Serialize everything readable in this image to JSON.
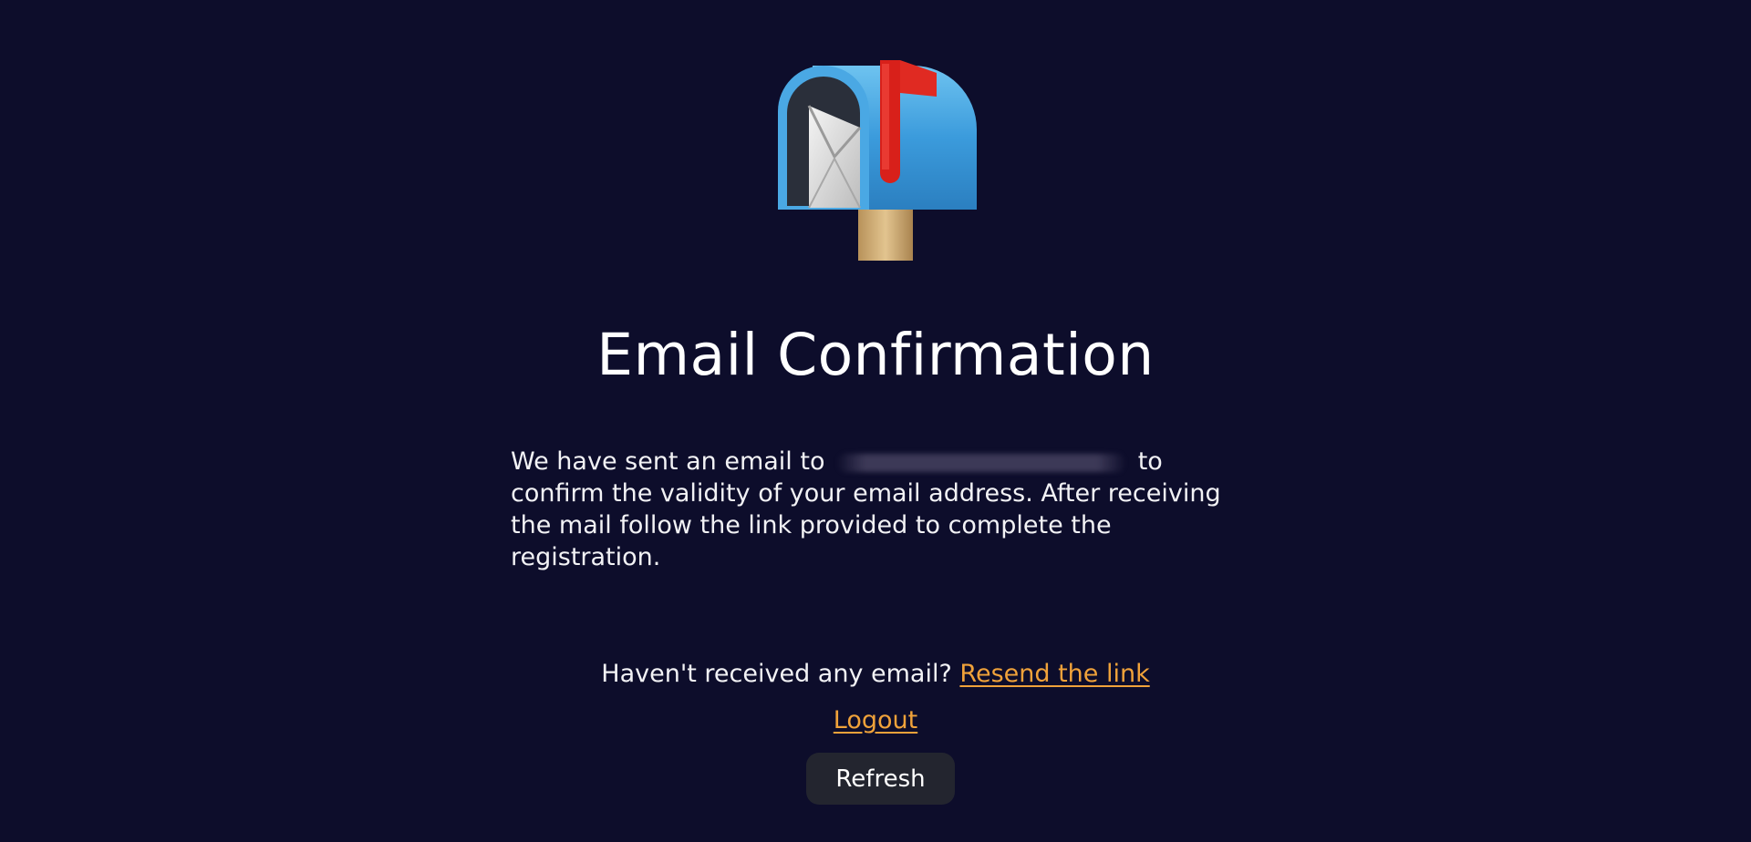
{
  "page": {
    "title": "Email Confirmation",
    "message_before": "We have sent an email to",
    "message_after": "to confirm the validity of your email address. After receiving the mail follow the link provided to complete the registration.",
    "resend_prompt": "Haven't received any email?",
    "resend_link": "Resend the link",
    "logout_link": "Logout",
    "refresh_button": "Refresh"
  },
  "icons": {
    "hero": "mailbox-with-flag-icon"
  },
  "colors": {
    "background": "#0d0d2b",
    "link": "#f0a23a",
    "button": "#23252f"
  }
}
